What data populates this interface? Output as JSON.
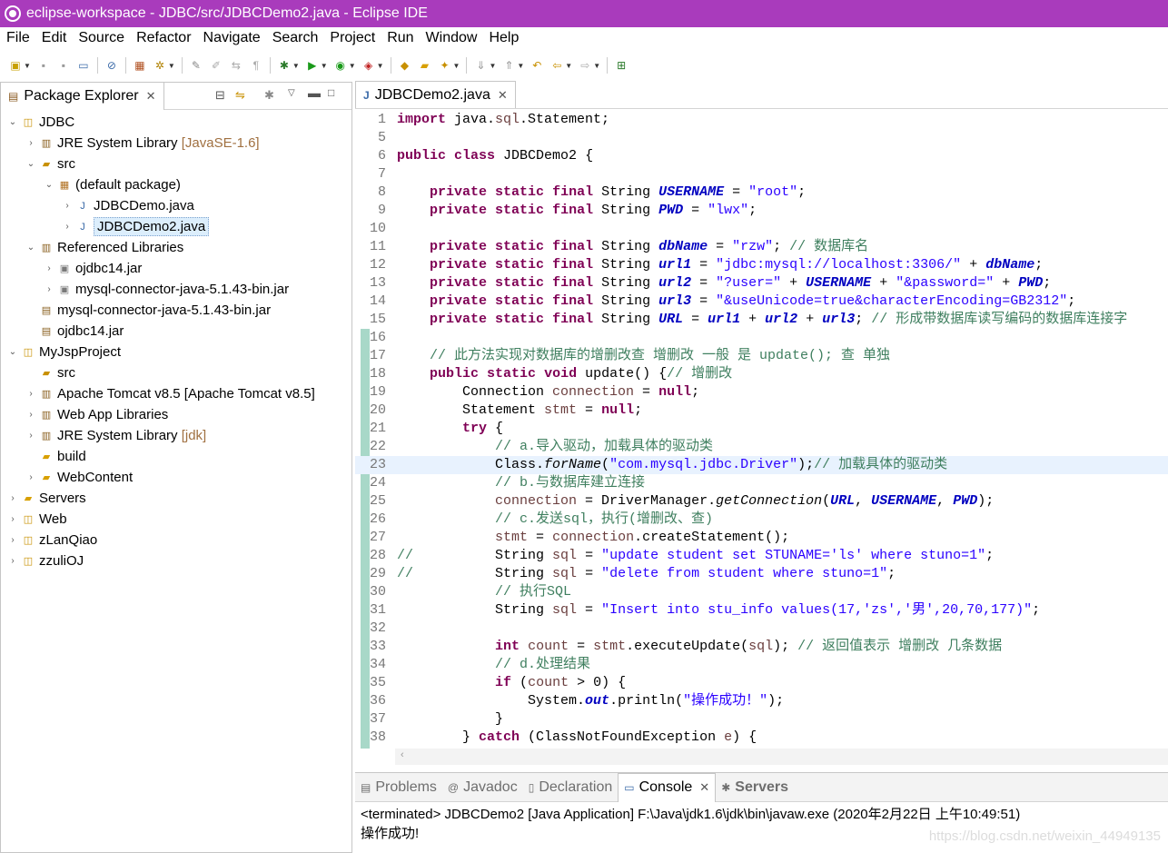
{
  "window": {
    "title": "eclipse-workspace - JDBC/src/JDBCDemo2.java - Eclipse IDE"
  },
  "menu": [
    "File",
    "Edit",
    "Source",
    "Refactor",
    "Navigate",
    "Search",
    "Project",
    "Run",
    "Window",
    "Help"
  ],
  "package_explorer": {
    "tab_label": "Package Explorer",
    "tree": [
      {
        "label": "JDBC",
        "suffix": ""
      },
      {
        "label": "JRE System Library",
        "suffix": "[JavaSE-1.6]"
      },
      {
        "label": "src",
        "suffix": ""
      },
      {
        "label": "(default package)",
        "suffix": ""
      },
      {
        "label": "JDBCDemo.java",
        "suffix": ""
      },
      {
        "label": "JDBCDemo2.java",
        "suffix": ""
      },
      {
        "label": "Referenced Libraries",
        "suffix": ""
      },
      {
        "label": "ojdbc14.jar",
        "suffix": ""
      },
      {
        "label": "mysql-connector-java-5.1.43-bin.jar",
        "suffix": ""
      },
      {
        "label": "mysql-connector-java-5.1.43-bin.jar",
        "suffix": ""
      },
      {
        "label": "ojdbc14.jar",
        "suffix": ""
      },
      {
        "label": "MyJspProject",
        "suffix": ""
      },
      {
        "label": "src",
        "suffix": ""
      },
      {
        "label": "Apache Tomcat v8.5 [Apache Tomcat v8.5]",
        "suffix": ""
      },
      {
        "label": "Web App Libraries",
        "suffix": ""
      },
      {
        "label": "JRE System Library",
        "suffix": "[jdk]"
      },
      {
        "label": "build",
        "suffix": ""
      },
      {
        "label": "WebContent",
        "suffix": ""
      },
      {
        "label": "Servers",
        "suffix": ""
      },
      {
        "label": "Web",
        "suffix": ""
      },
      {
        "label": "zLanQiao",
        "suffix": ""
      },
      {
        "label": "zzuliOJ",
        "suffix": ""
      }
    ]
  },
  "editor": {
    "tab_label": "JDBCDemo2.java",
    "lines": [
      {
        "n": "1",
        "code": "import java.sql.Statement;"
      },
      {
        "n": "5",
        "code": ""
      },
      {
        "n": "6",
        "code": "public class JDBCDemo2 {"
      },
      {
        "n": "7",
        "code": ""
      },
      {
        "n": "8",
        "code": "    private static final String USERNAME = \"root\";"
      },
      {
        "n": "9",
        "code": "    private static final String PWD = \"lwx\";"
      },
      {
        "n": "10",
        "code": ""
      },
      {
        "n": "11",
        "code": "    private static final String dbName = \"rzw\"; // 数据库名"
      },
      {
        "n": "12",
        "code": "    private static final String url1 = \"jdbc:mysql://localhost:3306/\" + dbName;"
      },
      {
        "n": "13",
        "code": "    private static final String url2 = \"?user=\" + USERNAME + \"&password=\" + PWD;"
      },
      {
        "n": "14",
        "code": "    private static final String url3 = \"&useUnicode=true&characterEncoding=GB2312\";"
      },
      {
        "n": "15",
        "code": "    private static final String URL = url1 + url2 + url3; // 形成带数据库读写编码的数据库连接字"
      },
      {
        "n": "16",
        "code": ""
      },
      {
        "n": "17",
        "code": "    // 此方法实现对数据库的增删改查 增删改 一般 是 update(); 查 单独"
      },
      {
        "n": "18",
        "code": "    public static void update() {// 增删改"
      },
      {
        "n": "19",
        "code": "        Connection connection = null;"
      },
      {
        "n": "20",
        "code": "        Statement stmt = null;"
      },
      {
        "n": "21",
        "code": "        try {"
      },
      {
        "n": "22",
        "code": "            // a.导入驱动，加载具体的驱动类"
      },
      {
        "n": "23",
        "code": "            Class.forName(\"com.mysql.jdbc.Driver\");// 加载具体的驱动类"
      },
      {
        "n": "24",
        "code": "            // b.与数据库建立连接"
      },
      {
        "n": "25",
        "code": "            connection = DriverManager.getConnection(URL, USERNAME, PWD);"
      },
      {
        "n": "26",
        "code": "            // c.发送sql，执行(增删改、查)"
      },
      {
        "n": "27",
        "code": "            stmt = connection.createStatement();"
      },
      {
        "n": "28",
        "code": "//          String sql = \"update student set STUNAME='ls' where stuno=1\";"
      },
      {
        "n": "29",
        "code": "//          String sql = \"delete from student where stuno=1\";"
      },
      {
        "n": "30",
        "code": "            // 执行SQL"
      },
      {
        "n": "31",
        "code": "            String sql = \"Insert into stu_info values(17,'zs','男',20,70,177)\";"
      },
      {
        "n": "32",
        "code": ""
      },
      {
        "n": "33",
        "code": "            int count = stmt.executeUpdate(sql); // 返回值表示 增删改 几条数据"
      },
      {
        "n": "34",
        "code": "            // d.处理结果"
      },
      {
        "n": "35",
        "code": "            if (count > 0) {"
      },
      {
        "n": "36",
        "code": "                System.out.println(\"操作成功！\");"
      },
      {
        "n": "37",
        "code": "            }"
      },
      {
        "n": "38",
        "code": "        } catch (ClassNotFoundException e) {"
      }
    ]
  },
  "bottom_panel": {
    "tabs": [
      "Problems",
      "Javadoc",
      "Declaration",
      "Console",
      "Servers"
    ],
    "active_tab": "Console",
    "console_header": "<terminated> JDBCDemo2 [Java Application] F:\\Java\\jdk1.6\\jdk\\bin\\javaw.exe (2020年2月22日 上午10:49:51)",
    "console_output": "操作成功!",
    "watermark": "https://blog.csdn.net/weixin_44949135"
  },
  "colors": {
    "titlebar": "#a93bbc",
    "keyword": "#7f0055",
    "string": "#2a00ff",
    "comment": "#3f7f5f",
    "field": "#0000c0"
  }
}
